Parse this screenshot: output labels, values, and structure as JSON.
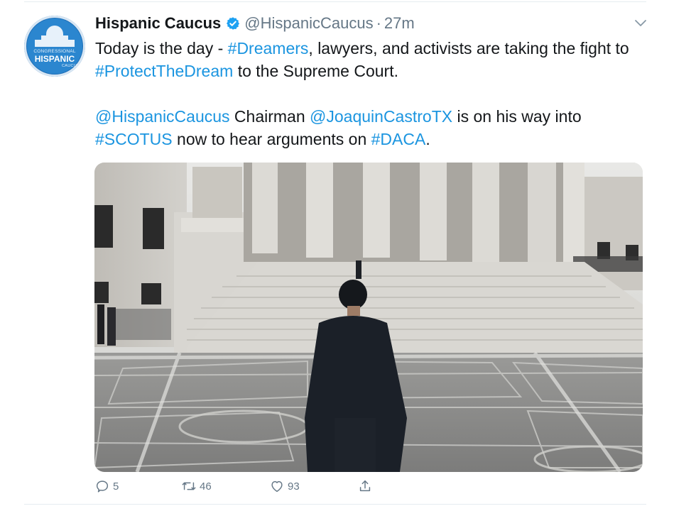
{
  "tweet": {
    "display_name": "Hispanic Caucus",
    "handle": "@HispanicCaucus",
    "separator": "·",
    "time": "27m",
    "avatar": {
      "line1": "CONGRESSIONAL",
      "line2": "HISPANIC",
      "line3": "CAUCUS"
    },
    "paragraph1": {
      "t1": "Today is the day - ",
      "h1": "#Dreamers",
      "t2": ", lawyers,  and activists are taking the fight to ",
      "h2": "#ProtectTheDream",
      "t3": " to the Supreme Court."
    },
    "paragraph2": {
      "m1": "@HispanicCaucus",
      "t1": " Chairman ",
      "m2": "@JoaquinCastroTX",
      "t2": " is on his way into ",
      "h1": "#SCOTUS",
      "t3": " now to hear arguments on ",
      "h2": "#DACA",
      "t4": "."
    },
    "actions": {
      "replies": "5",
      "retweets": "46",
      "likes": "93"
    }
  },
  "icons": {
    "verified": "verified-badge-icon",
    "caret": "chevron-down-icon",
    "reply": "reply-icon",
    "retweet": "retweet-icon",
    "like": "heart-icon",
    "share": "share-icon"
  },
  "colors": {
    "link": "#1b95e0",
    "muted": "#657786",
    "text": "#14171a",
    "verified": "#1da1f2"
  }
}
